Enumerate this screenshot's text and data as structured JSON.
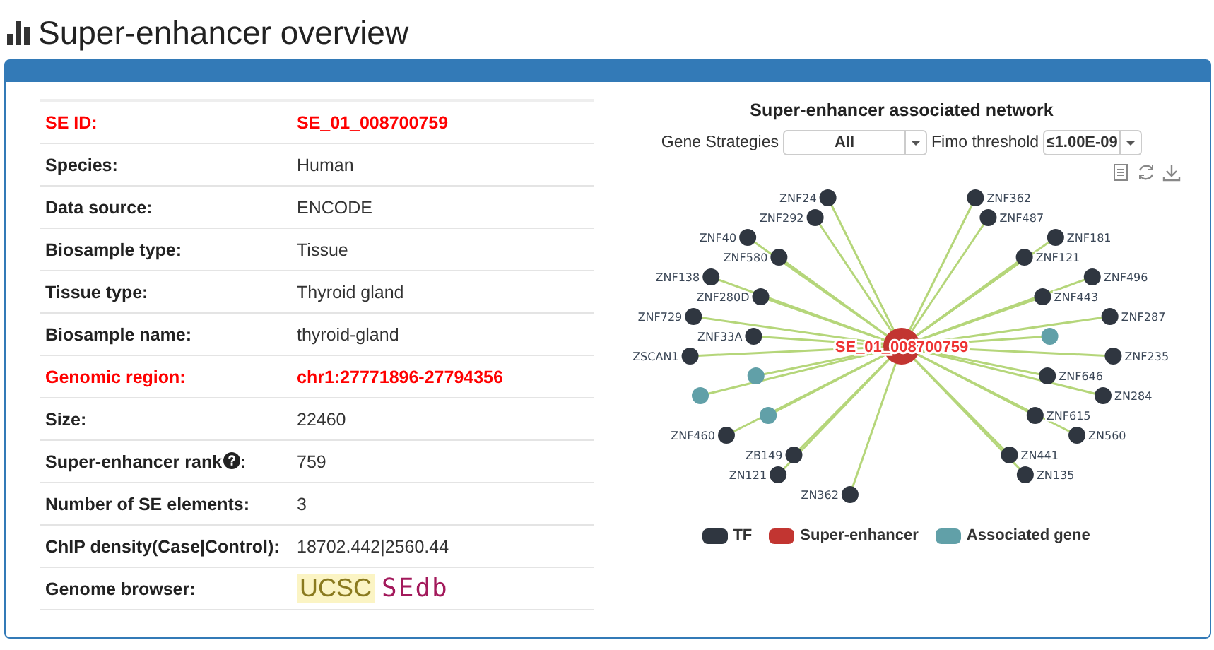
{
  "page": {
    "title": "Super-enhancer overview"
  },
  "details": [
    {
      "label": "SE ID:",
      "value": "SE_01_008700759",
      "highlight": true,
      "kind": "text"
    },
    {
      "label": "Species:",
      "value": "Human",
      "highlight": false,
      "kind": "text"
    },
    {
      "label": "Data source:",
      "value": "ENCODE",
      "highlight": false,
      "kind": "text"
    },
    {
      "label": "Biosample type:",
      "value": "Tissue",
      "highlight": false,
      "kind": "text"
    },
    {
      "label": "Tissue type:",
      "value": "Thyroid gland",
      "highlight": false,
      "kind": "text"
    },
    {
      "label": "Biosample name:",
      "value": "thyroid-gland",
      "highlight": false,
      "kind": "text"
    },
    {
      "label": "Genomic region:",
      "value": "chr1:27771896-27794356",
      "highlight": true,
      "kind": "text"
    },
    {
      "label": "Size:",
      "value": "22460",
      "highlight": false,
      "kind": "text"
    },
    {
      "label": "Super-enhancer rank",
      "help": true,
      "suffix": ":",
      "value": "759",
      "highlight": false,
      "kind": "text"
    },
    {
      "label": "Number of SE elements:",
      "value": "3",
      "highlight": false,
      "kind": "text"
    },
    {
      "label": "ChIP density(Case|Control):",
      "value": "18702.442|2560.44",
      "highlight": false,
      "kind": "text"
    },
    {
      "label": "Genome browser:",
      "kind": "links",
      "highlight": false,
      "links": [
        {
          "text": "UCSC",
          "kind": "ucsc"
        },
        {
          "text": "SEdb",
          "kind": "sedb"
        }
      ]
    }
  ],
  "network": {
    "title": "Super-enhancer associated network",
    "filters": [
      {
        "label": "Gene Strategies",
        "value": "All",
        "kind": "wide"
      },
      {
        "label": "Fimo threshold",
        "value": "≤1.00E-09",
        "kind": "narrow"
      }
    ],
    "hub": {
      "label": "SE_01_008700759",
      "kind": "se"
    },
    "nodes": [
      {
        "label": "ZNF24",
        "kind": "tf"
      },
      {
        "label": "ZNF362",
        "kind": "tf"
      },
      {
        "label": "ZNF292",
        "kind": "tf"
      },
      {
        "label": "ZNF487",
        "kind": "tf"
      },
      {
        "label": "ZNF40",
        "kind": "tf"
      },
      {
        "label": "ZNF181",
        "kind": "tf"
      },
      {
        "label": "ZNF580",
        "kind": "tf"
      },
      {
        "label": "ZNF121",
        "kind": "tf"
      },
      {
        "label": "ZNF138",
        "kind": "tf"
      },
      {
        "label": "ZNF496",
        "kind": "tf"
      },
      {
        "label": "ZNF280D",
        "kind": "tf"
      },
      {
        "label": "ZNF443",
        "kind": "tf"
      },
      {
        "label": "ZNF729",
        "kind": "tf"
      },
      {
        "label": "ZNF287",
        "kind": "tf"
      },
      {
        "label": "ZNF33A",
        "kind": "tf"
      },
      {
        "kind": "gene"
      },
      {
        "label": "ZSCAN1",
        "kind": "tf"
      },
      {
        "label": "ZNF235",
        "kind": "tf"
      },
      {
        "kind": "gene"
      },
      {
        "label": "ZNF646",
        "kind": "tf"
      },
      {
        "kind": "gene"
      },
      {
        "label": "ZN284",
        "kind": "tf"
      },
      {
        "kind": "gene"
      },
      {
        "label": "ZNF615",
        "kind": "tf"
      },
      {
        "label": "ZNF460",
        "kind": "tf"
      },
      {
        "label": "ZN560",
        "kind": "tf"
      },
      {
        "label": "ZB149",
        "kind": "tf"
      },
      {
        "label": "ZN441",
        "kind": "tf"
      },
      {
        "label": "ZN121",
        "kind": "tf"
      },
      {
        "label": "ZN135",
        "kind": "tf"
      },
      {
        "label": "ZN362",
        "kind": "tf"
      }
    ],
    "legend": [
      {
        "label": "TF",
        "kind": "tf",
        "color": "#2f3640"
      },
      {
        "label": "Super-enhancer",
        "kind": "se",
        "color": "#c23531"
      },
      {
        "label": "Associated gene",
        "kind": "gene",
        "color": "#61a0a8"
      }
    ]
  }
}
